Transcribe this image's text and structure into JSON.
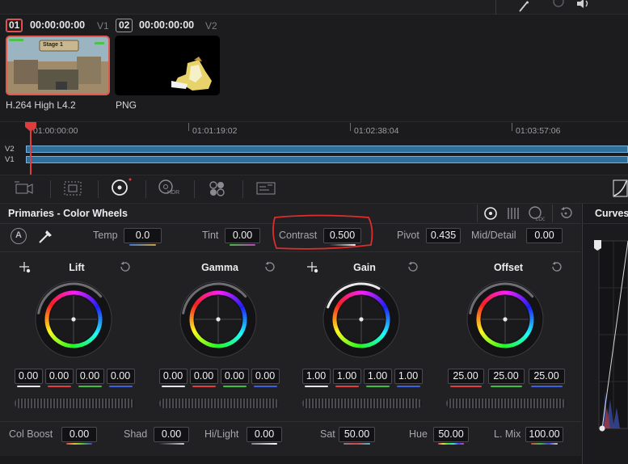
{
  "clips": [
    {
      "number": "01",
      "timecode": "00:00:00:00",
      "track": "V1",
      "codec": "H.264 High L4.2",
      "thumb_caption": "Stage 1"
    },
    {
      "number": "02",
      "timecode": "00:00:00:00",
      "track": "V2",
      "codec": "PNG"
    }
  ],
  "timeline": {
    "ticks": [
      "01:00:00:00",
      "01:01:19:02",
      "01:02:38:04",
      "01:03:57:06"
    ],
    "tracks": [
      "V2",
      "V1"
    ]
  },
  "toolbar": {
    "tools": [
      "camera-raw-icon",
      "color-match-icon",
      "primaries-icon",
      "hdr-icon",
      "rgb-mixer-icon",
      "motion-effects-icon"
    ],
    "hdr_label": "HDR"
  },
  "primaries": {
    "title": "Primaries - Color Wheels",
    "auto_label": "A",
    "temp_label": "Temp",
    "temp_value": "0.0",
    "tint_label": "Tint",
    "tint_value": "0.00",
    "contrast_label": "Contrast",
    "contrast_value": "0.500",
    "pivot_label": "Pivot",
    "pivot_value": "0.435",
    "middetail_label": "Mid/Detail",
    "middetail_value": "0.00",
    "wheels": [
      {
        "name": "Lift",
        "values": [
          "0.00",
          "0.00",
          "0.00",
          "0.00"
        ]
      },
      {
        "name": "Gamma",
        "values": [
          "0.00",
          "0.00",
          "0.00",
          "0.00"
        ]
      },
      {
        "name": "Gain",
        "values": [
          "1.00",
          "1.00",
          "1.00",
          "1.00"
        ]
      },
      {
        "name": "Offset",
        "values": [
          "25.00",
          "25.00",
          "25.00"
        ]
      }
    ],
    "colboost_label": "Col Boost",
    "colboost_value": "0.00",
    "shad_label": "Shad",
    "shad_value": "0.00",
    "hilight_label": "Hi/Light",
    "hilight_value": "0.00",
    "sat_label": "Sat",
    "sat_value": "50.00",
    "hue_label": "Hue",
    "hue_value": "50.00",
    "lmix_label": "L. Mix",
    "lmix_value": "100.00"
  },
  "curves": {
    "title": "Curves"
  },
  "colors": {
    "highlight": "#e02c2c",
    "track_blue": "#2f6f9c",
    "accent": "#e23b3b"
  }
}
